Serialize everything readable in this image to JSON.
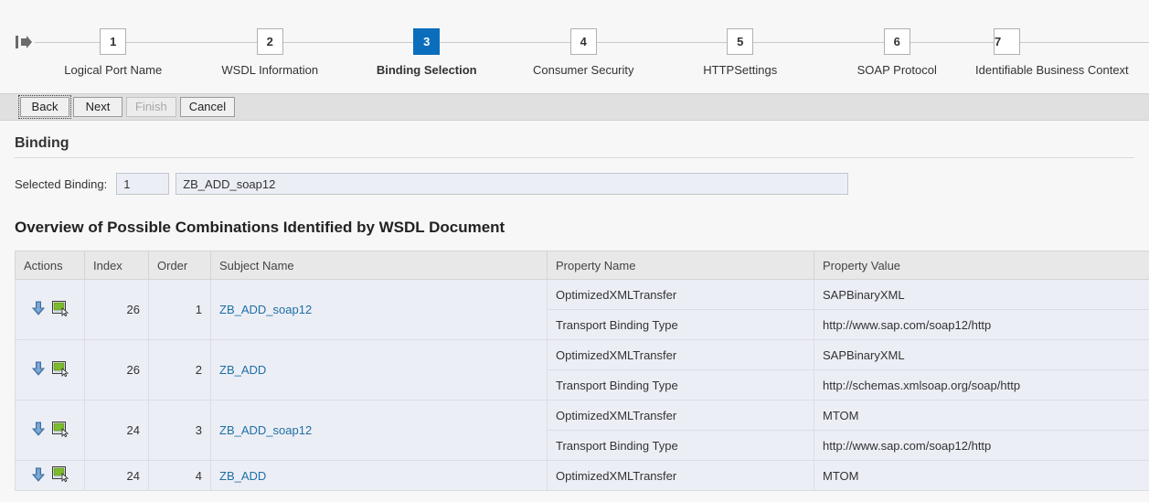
{
  "roadmap": {
    "start_icon": "start-arrow-icon",
    "active_step": 3,
    "steps": [
      {
        "number": "1",
        "label": "Logical Port Name"
      },
      {
        "number": "2",
        "label": "WSDL Information"
      },
      {
        "number": "3",
        "label": "Binding Selection"
      },
      {
        "number": "4",
        "label": "Consumer Security"
      },
      {
        "number": "5",
        "label": "HTTPSettings"
      },
      {
        "number": "6",
        "label": "SOAP Protocol"
      },
      {
        "number": "7",
        "label": "Identifiable Business Context"
      }
    ]
  },
  "toolbar": {
    "back_label": "Back",
    "next_label": "Next",
    "finish_label": "Finish",
    "cancel_label": "Cancel"
  },
  "binding_section": {
    "title": "Binding",
    "selected_binding_label": "Selected Binding:",
    "selected_index_value": "1",
    "selected_name_value": "ZB_ADD_soap12"
  },
  "overview": {
    "title": "Overview of Possible Combinations Identified by WSDL Document",
    "columns": {
      "actions": "Actions",
      "index": "Index",
      "order": "Order",
      "subject_name": "Subject Name",
      "property_name": "Property Name",
      "property_value": "Property Value"
    },
    "rows": [
      {
        "index": "26",
        "order": "1",
        "subject_name": "ZB_ADD_soap12",
        "properties": [
          {
            "name": "OptimizedXMLTransfer",
            "value": "SAPBinaryXML"
          },
          {
            "name": "Transport Binding Type",
            "value": "http://www.sap.com/soap12/http"
          }
        ]
      },
      {
        "index": "26",
        "order": "2",
        "subject_name": "ZB_ADD",
        "properties": [
          {
            "name": "OptimizedXMLTransfer",
            "value": "SAPBinaryXML"
          },
          {
            "name": "Transport Binding Type",
            "value": "http://schemas.xmlsoap.org/soap/http"
          }
        ]
      },
      {
        "index": "24",
        "order": "3",
        "subject_name": "ZB_ADD_soap12",
        "properties": [
          {
            "name": "OptimizedXMLTransfer",
            "value": "MTOM"
          },
          {
            "name": "Transport Binding Type",
            "value": "http://www.sap.com/soap12/http"
          }
        ]
      },
      {
        "index": "24",
        "order": "4",
        "subject_name": "ZB_ADD",
        "properties": [
          {
            "name": "OptimizedXMLTransfer",
            "value": "MTOM"
          }
        ]
      }
    ],
    "row_icons": {
      "apply": "download-arrow-icon",
      "display": "display-screen-icon"
    }
  },
  "colors": {
    "accent": "#0a6ebd",
    "link": "#1d6fa5",
    "field_background": "#eceef6",
    "header_background": "#e8e8e8",
    "toolbar_background": "#e0e0e0",
    "page_background": "#f7f7f7"
  }
}
